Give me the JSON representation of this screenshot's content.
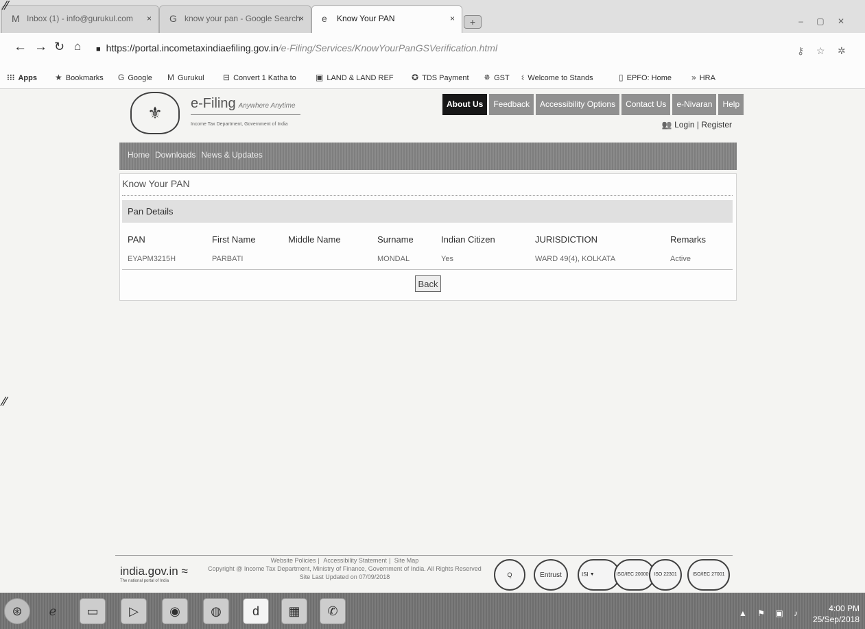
{
  "browser": {
    "tabs": [
      {
        "label": "Inbox (1) - info@gurukul.com",
        "icon": "gmail-icon",
        "active": false
      },
      {
        "label": "know your pan - Google Search",
        "icon": "google-icon",
        "active": false
      },
      {
        "label": "Know Your PAN",
        "icon": "ie-icon",
        "active": true
      }
    ],
    "close_glyph": "×",
    "new_tab_glyph": "+",
    "url_host": "https://portal.incometaxindiaefiling.gov.in",
    "url_path": "/e-Filing/Services/KnowYourPanGSVerification.html"
  },
  "bookmarks": [
    {
      "label": "Apps",
      "icon": "apps-grid-icon"
    },
    {
      "label": "Bookmarks",
      "icon": "star-icon"
    },
    {
      "label": "Google",
      "icon": "google-icon"
    },
    {
      "label": "Gurukul",
      "icon": "gmail-icon"
    },
    {
      "label": "Convert 1 Katha to",
      "icon": "page-icon"
    },
    {
      "label": "LAND & LAND REF",
      "icon": "doc-icon"
    },
    {
      "label": "TDS Payment",
      "icon": "tds-icon"
    },
    {
      "label": "GST",
      "icon": "gst-icon"
    },
    {
      "label": "Welcome to Stands",
      "icon": "site-icon"
    },
    {
      "label": "EPFO: Home",
      "icon": "file-icon"
    },
    {
      "label": "HRA",
      "icon": ""
    }
  ],
  "site": {
    "brand_title": "e-Filing",
    "brand_tagline": "Anywhere Anytime",
    "brand_sub": "Income Tax Department, Government of India",
    "top_nav": [
      "About Us",
      "Feedback",
      "Accessibility Options",
      "Contact Us",
      "e-Nivaran",
      "Help"
    ],
    "login_label": "Login",
    "register_label": "Register",
    "main_nav": [
      "Home",
      "Downloads",
      "News & Updates"
    ]
  },
  "pan": {
    "page_title": "Know Your PAN",
    "section_title": "Pan Details",
    "columns": [
      "PAN",
      "First Name",
      "Middle Name",
      "Surname",
      "Indian Citizen",
      "JURISDICTION",
      "Remarks"
    ],
    "row": {
      "pan": "EYAPM3215H",
      "first_name": "PARBATI",
      "middle_name": "",
      "surname": "MONDAL",
      "indian_citizen": "Yes",
      "jurisdiction": "WARD 49(4), KOLKATA",
      "remarks": "Active"
    },
    "back_label": "Back"
  },
  "footer": {
    "india_logo": "india.gov.in",
    "india_sub": "The national portal of India",
    "links": [
      "Website Policies",
      "Accessibility Statement",
      "Site Map"
    ],
    "copyright": "Copyright @ Income Tax Department, Ministry of Finance, Government of India. All Rights Reserved",
    "last_updated": "Site Last Updated on 07/09/2018",
    "seals": [
      "Q",
      "Entrust",
      "ISI",
      "ISO/IEC 20000-1",
      "ISO 22301",
      "ISO/IEC 27001"
    ]
  },
  "taskbar": {
    "time": "4:00 PM",
    "date": "25/Sep/2018"
  }
}
